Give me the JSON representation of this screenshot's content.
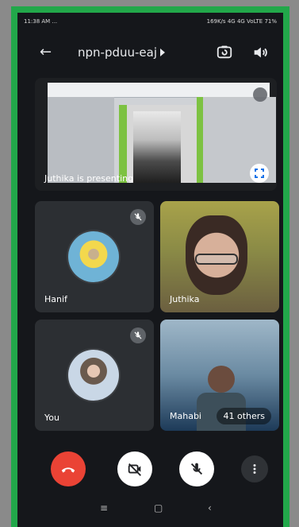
{
  "status_bar": {
    "time": "11:38 AM",
    "dots": "...",
    "speed": "169K/s",
    "net1": "4G",
    "net2": "4G VoLTE",
    "battery": "71%"
  },
  "header": {
    "meeting_code": "npn-pduu-eaj"
  },
  "presentation": {
    "presenter_label": "Juthika is presenting"
  },
  "participants": [
    {
      "name": "Hanif",
      "muted": true,
      "has_video": false
    },
    {
      "name": "Juthika",
      "muted": false,
      "has_video": true
    },
    {
      "name": "You",
      "muted": true,
      "has_video": false
    },
    {
      "name": "Mahabi",
      "muted": false,
      "has_video": true
    }
  ],
  "others_badge": "41 others",
  "colors": {
    "frame_green": "#22a84a",
    "end_call_red": "#ea4335",
    "tile_bg": "#2c2f33"
  },
  "icons": {
    "back": "back-arrow-icon",
    "switch_camera": "switch-camera-icon",
    "speaker": "speaker-icon",
    "fullscreen": "fullscreen-icon",
    "mute": "mic-off-icon",
    "end_call": "end-call-icon",
    "camera_off": "camera-off-icon",
    "mic_off": "mic-off-icon",
    "more": "more-vert-icon",
    "nav_menu": "menu-icon",
    "nav_home": "home-icon",
    "nav_back": "nav-back-icon"
  }
}
